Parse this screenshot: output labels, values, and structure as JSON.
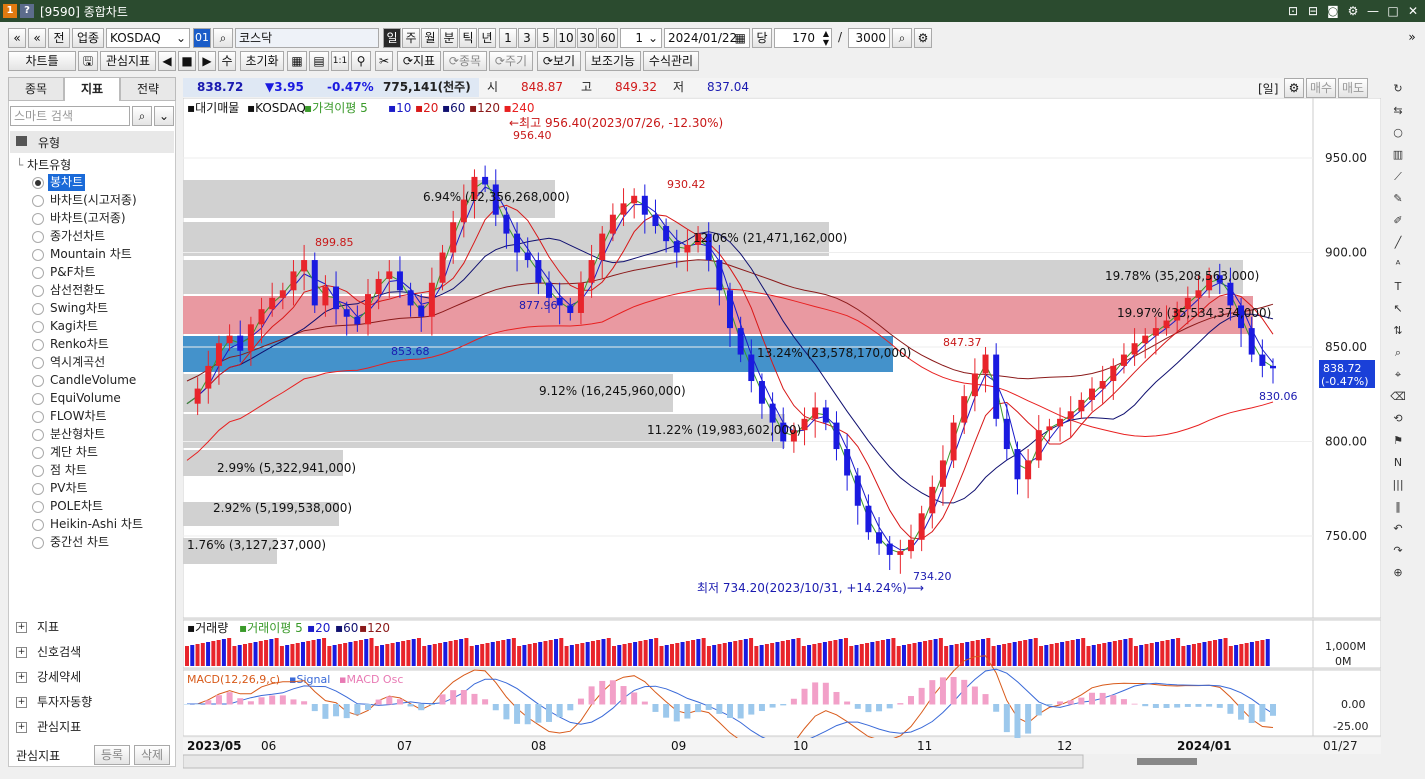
{
  "window": {
    "icon1": "1",
    "icon2": "?",
    "title": "[9590] 종합차트",
    "buttons": [
      "⊡",
      "⊟",
      "◙",
      "⚙",
      "—",
      "□",
      "✕"
    ]
  },
  "toolbar1": {
    "nav_first": "«",
    "nav_up": "«",
    "btn_prev": "전",
    "btn_sector": "업종",
    "market": "KOSDAQ",
    "code": "01",
    "search_icon": "⌕",
    "name": "코스닥",
    "periods": [
      "일",
      "주",
      "월",
      "분",
      "틱",
      "년"
    ],
    "active_period": "일",
    "intervals": [
      "1",
      "3",
      "5",
      "10",
      "30",
      "60"
    ],
    "interval_value": "1",
    "date": "2024/01/22",
    "count_label": "당",
    "count": "170",
    "slash": "/",
    "total": "3000"
  },
  "toolbar2": {
    "chart_type": "차트틀",
    "watch": "관심지표",
    "play": "▶",
    "btn_count": "수",
    "reset": "초기화",
    "indicator": "지표",
    "item": "종목",
    "cycle": "주기",
    "view": "보기",
    "aux": "보조기능",
    "formula": "수식관리"
  },
  "left_tabs": [
    "종목",
    "지표",
    "전략"
  ],
  "active_left_tab": "지표",
  "search": {
    "placeholder": "스마트 검색"
  },
  "tree": {
    "group": "유형",
    "sub": "차트유형",
    "items": [
      "봉차트",
      "바차트(시고저종)",
      "바차트(고저종)",
      "종가선차트",
      "Mountain 차트",
      "P&F차트",
      "삼선전환도",
      "Swing차트",
      "Kagi차트",
      "Renko차트",
      "역시계곡선",
      "CandleVolume",
      "EquiVolume",
      "FLOW차트",
      "분산형차트",
      "계단 차트",
      "점 차트",
      "PV차트",
      "POLE차트",
      "Heikin-Ashi 차트",
      "중간선 차트"
    ],
    "selected": "봉차트"
  },
  "sections": [
    "지표",
    "신호검색",
    "강세약세",
    "투자자동향",
    "관심지표"
  ],
  "bottom_left": {
    "label": "관심지표",
    "add": "등록",
    "del": "삭제"
  },
  "quote": {
    "price": "838.72",
    "change": "▼3.95",
    "rate": "-0.47%",
    "volume": "775,141(천주)",
    "open_label": "시",
    "open": "848.87",
    "high_label": "고",
    "high": "849.32",
    "low_label": "저",
    "low": "837.04",
    "period_btn": "[일]",
    "buy": "매수",
    "sell": "매도"
  },
  "legend": {
    "items": [
      "대기매물",
      "KOSDAQ",
      "가격이평 5",
      "10",
      "20",
      "60",
      "120",
      "240"
    ]
  },
  "colors": {
    "up": "#e8242b",
    "down": "#1a1ae0",
    "ma5": "#3a9a2a",
    "ma10": "#1a1ac8",
    "ma20": "#d81818",
    "ma60": "#101070",
    "ma120": "#8b1a1a",
    "ma240": "#e82020",
    "volband": "#cfcfcf",
    "pinkband": "#e8949c",
    "blueband": "#3a8cc8"
  },
  "annotations": {
    "high_label": "←최고 956.40(2023/07/26, -12.30%)",
    "low_label": "최저 734.20(2023/10/31, +14.24%)⟶",
    "p1": "899.85",
    "p2": "930.42",
    "p3": "853.68",
    "p4": "877.96",
    "p5": "847.37",
    "p6": "956.40",
    "p7": "734.20",
    "p8": "830.06"
  },
  "volume_profile": [
    {
      "pct": "1.76%",
      "val": "(3,127,237,000)"
    },
    {
      "pct": "2.92%",
      "val": "(5,199,538,000)"
    },
    {
      "pct": "2.99%",
      "val": "(5,322,941,000)"
    },
    {
      "pct": "11.22%",
      "val": "(19,983,602,000)"
    },
    {
      "pct": "9.12%",
      "val": "(16,245,960,000)"
    },
    {
      "pct": "13.24%",
      "val": "(23,578,170,000)"
    },
    {
      "pct": "19.97%",
      "val": "(35,534,374,000)"
    },
    {
      "pct": "19.78%",
      "val": "(35,208,563,000)"
    },
    {
      "pct": "12.06%",
      "val": "(21,471,162,000)"
    },
    {
      "pct": "6.94%",
      "val": "(12,356,268,000)"
    }
  ],
  "price_axis": {
    "ticks": [
      "950.00",
      "900.00",
      "850.00",
      "800.00",
      "750.00"
    ],
    "current": "838.72",
    "current_rate": "(-0.47%)"
  },
  "volume_panel": {
    "title": "거래량",
    "ma5": "거래이평 5",
    "ma20": "20",
    "ma60": "60",
    "ma120": "120",
    "ticks": [
      "1,000M",
      "0M"
    ]
  },
  "macd_panel": {
    "title": "MACD(12,26,9,c)",
    "signal": "Signal",
    "osc": "MACD Osc",
    "ticks": [
      "0.00",
      "-25.00"
    ]
  },
  "x_axis": {
    "labels": [
      "2023/05",
      "06",
      "07",
      "08",
      "09",
      "10",
      "11",
      "12",
      "2024/01"
    ],
    "last": "01/27"
  },
  "chart_data": {
    "type": "candlestick",
    "ylim": [
      720,
      980
    ],
    "highest": {
      "value": 956.4,
      "date": "2023/07/26"
    },
    "lowest": {
      "value": 734.2,
      "date": "2023/10/31"
    },
    "close_path": [
      820,
      828,
      840,
      852,
      856,
      848,
      862,
      870,
      876,
      880,
      890,
      896,
      872,
      882,
      870,
      866,
      862,
      878,
      886,
      890,
      880,
      872,
      866,
      884,
      900,
      916,
      928,
      940,
      936,
      920,
      910,
      900,
      896,
      884,
      876,
      872,
      868,
      884,
      896,
      910,
      920,
      926,
      930,
      920,
      914,
      906,
      900,
      904,
      910,
      896,
      880,
      860,
      846,
      832,
      820,
      810,
      800,
      806,
      812,
      818,
      810,
      796,
      782,
      766,
      752,
      746,
      740,
      742,
      748,
      762,
      776,
      790,
      810,
      824,
      836,
      846,
      812,
      796,
      780,
      790,
      806,
      808,
      812,
      816,
      822,
      828,
      832,
      840,
      846,
      852,
      856,
      860,
      864,
      870,
      876,
      880,
      888,
      884,
      872,
      860,
      846,
      840,
      838.72
    ]
  }
}
